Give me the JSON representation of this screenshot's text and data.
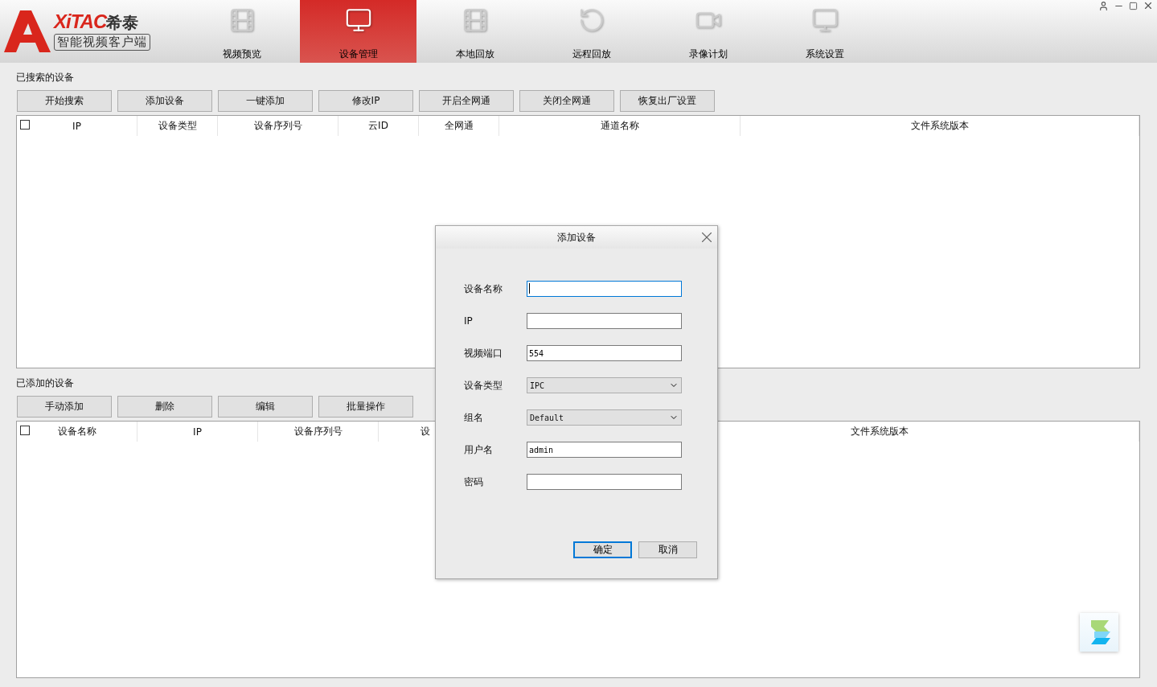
{
  "logo": {
    "brand": "XiTAC",
    "brand_cn": "希泰",
    "subtitle": "智能视频客户端"
  },
  "tabs": [
    {
      "label": "视频预览",
      "kind": "preview",
      "selected": false
    },
    {
      "label": "设备管理",
      "kind": "devices",
      "selected": true
    },
    {
      "label": "本地回放",
      "kind": "local",
      "selected": false
    },
    {
      "label": "远程回放",
      "kind": "remote",
      "selected": false
    },
    {
      "label": "录像计划",
      "kind": "schedule",
      "selected": false
    },
    {
      "label": "系统设置",
      "kind": "settings",
      "selected": false
    }
  ],
  "searched": {
    "title": "已搜索的设备",
    "buttons": [
      "开始搜索",
      "添加设备",
      "一键添加",
      "修改IP",
      "开启全网通",
      "关闭全网通",
      "恢复出厂设置"
    ],
    "select_all": {
      "checked": false
    },
    "columns": [
      "IP",
      "设备类型",
      "设备序列号",
      "云ID",
      "全网通",
      "通道名称",
      "文件系统版本"
    ]
  },
  "added": {
    "title": "已添加的设备",
    "buttons": [
      "手动添加",
      "删除",
      "编辑",
      "批量操作"
    ],
    "select_all": {
      "checked": false
    },
    "columns": [
      "设备名称",
      "IP",
      "设备序列号",
      "设",
      "文件系统版本"
    ]
  },
  "dialog": {
    "title": "添加设备",
    "fields": [
      {
        "label": "设备名称",
        "kind": "text",
        "focused": true
      },
      {
        "label": "IP",
        "kind": "text",
        "focused": false
      },
      {
        "label": "视频端口",
        "kind": "text",
        "value": "554",
        "focused": false
      },
      {
        "label": "设备类型",
        "kind": "select",
        "value": "IPC"
      },
      {
        "label": "组名",
        "kind": "select",
        "value": "Default"
      },
      {
        "label": "用户名",
        "kind": "text",
        "value": "admin",
        "focused": false
      },
      {
        "label": "密码",
        "kind": "password",
        "focused": false
      }
    ],
    "buttons": [
      {
        "label": "确定",
        "focused": true
      },
      {
        "label": "取消",
        "focused": false
      }
    ]
  }
}
